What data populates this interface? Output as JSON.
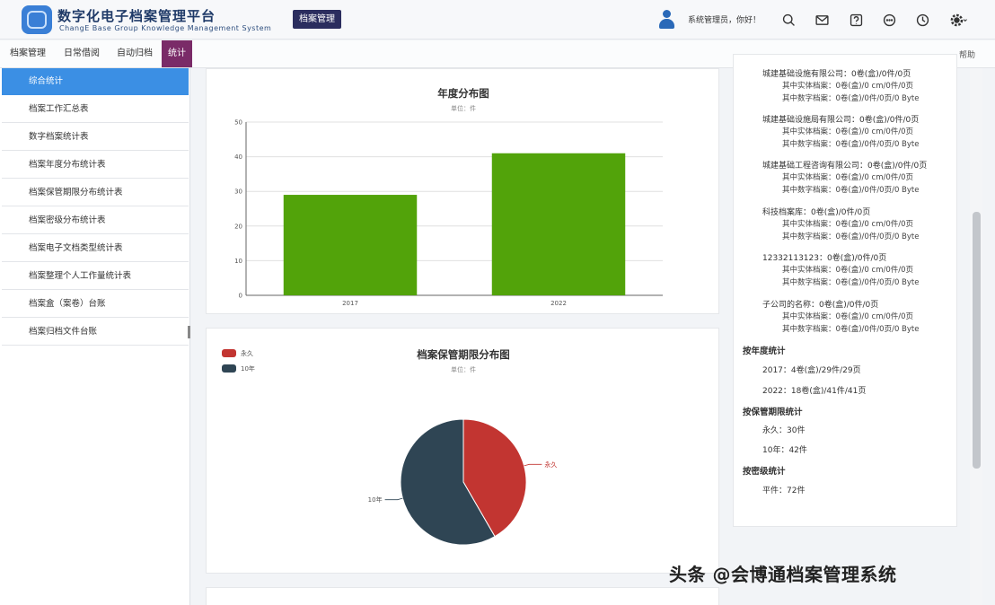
{
  "header": {
    "title": "数字化电子档案管理平台",
    "subtitle": "ChangE Base Group Knowledge Management System",
    "badge": "档案管理",
    "greeting": "系统管理员，你好！"
  },
  "nav": {
    "items": [
      {
        "label": "档案管理",
        "active": false
      },
      {
        "label": "日常借阅",
        "active": false
      },
      {
        "label": "自动归档",
        "active": false
      },
      {
        "label": "统计",
        "active": true
      }
    ],
    "right_label": "帮助"
  },
  "sidebar": {
    "items": [
      {
        "label": "综合统计",
        "active": true
      },
      {
        "label": "档案工作汇总表",
        "active": false
      },
      {
        "label": "数字档案统计表",
        "active": false
      },
      {
        "label": "档案年度分布统计表",
        "active": false
      },
      {
        "label": "档案保管期限分布统计表",
        "active": false
      },
      {
        "label": "档案密级分布统计表",
        "active": false
      },
      {
        "label": "档案电子文档类型统计表",
        "active": false
      },
      {
        "label": "档案整理个人工作量统计表",
        "active": false
      },
      {
        "label": "档案盒（案卷）台账",
        "active": false
      },
      {
        "label": "档案归档文件台账",
        "active": false
      }
    ]
  },
  "bar_chart": {
    "title": "年度分布图",
    "subtitle": "单位：件",
    "chart_data": {
      "type": "bar",
      "categories": [
        "2017",
        "2022"
      ],
      "values": [
        29,
        41
      ],
      "title": "年度分布图",
      "ylim": [
        0,
        50
      ],
      "yticks": [
        0,
        10,
        20,
        30,
        40,
        50
      ],
      "color": "#52a30a",
      "grid": true
    }
  },
  "pie_chart": {
    "title": "档案保管期限分布图",
    "subtitle": "单位：件",
    "chart_data": {
      "type": "pie",
      "labels": [
        "永久",
        "10年"
      ],
      "values": [
        30,
        42
      ],
      "colors": [
        "#c23531",
        "#2f4554"
      ],
      "legend": "top-left"
    }
  },
  "info": {
    "blocks": [
      {
        "head": "城建基础设施有限公司：0卷(盒)/0件/0页",
        "lines": [
          "其中实体档案：0卷(盒)/0 cm/0件/0页",
          "其中数字档案：0卷(盒)/0件/0页/0 Byte"
        ]
      },
      {
        "head": "城建基础设施局有限公司：0卷(盒)/0件/0页",
        "lines": [
          "其中实体档案：0卷(盒)/0 cm/0件/0页",
          "其中数字档案：0卷(盒)/0件/0页/0 Byte"
        ]
      },
      {
        "head": "城建基础工程咨询有限公司：0卷(盒)/0件/0页",
        "lines": [
          "其中实体档案：0卷(盒)/0 cm/0件/0页",
          "其中数字档案：0卷(盒)/0件/0页/0 Byte"
        ]
      },
      {
        "head": "科技档案库：0卷(盒)/0件/0页",
        "lines": [
          "其中实体档案：0卷(盒)/0 cm/0件/0页",
          "其中数字档案：0卷(盒)/0件/0页/0 Byte"
        ]
      },
      {
        "head": "12332113123：0卷(盒)/0件/0页",
        "lines": [
          "其中实体档案：0卷(盒)/0 cm/0件/0页",
          "其中数字档案：0卷(盒)/0件/0页/0 Byte"
        ]
      },
      {
        "head": "子公司的名称：0卷(盒)/0件/0页",
        "lines": [
          "其中实体档案：0卷(盒)/0 cm/0件/0页",
          "其中数字档案：0卷(盒)/0件/0页/0 Byte"
        ]
      }
    ],
    "year_head": "按年度统计",
    "year_lines": [
      "2017：4卷(盒)/29件/29页",
      "2022：18卷(盒)/41件/41页"
    ],
    "period_head": "按保管期限统计",
    "period_lines": [
      "永久：30件",
      "10年：42件"
    ],
    "secret_head": "按密级统计",
    "secret_lines": [
      "平件：72件"
    ]
  },
  "watermark": "头条 @会博通档案管理系统"
}
